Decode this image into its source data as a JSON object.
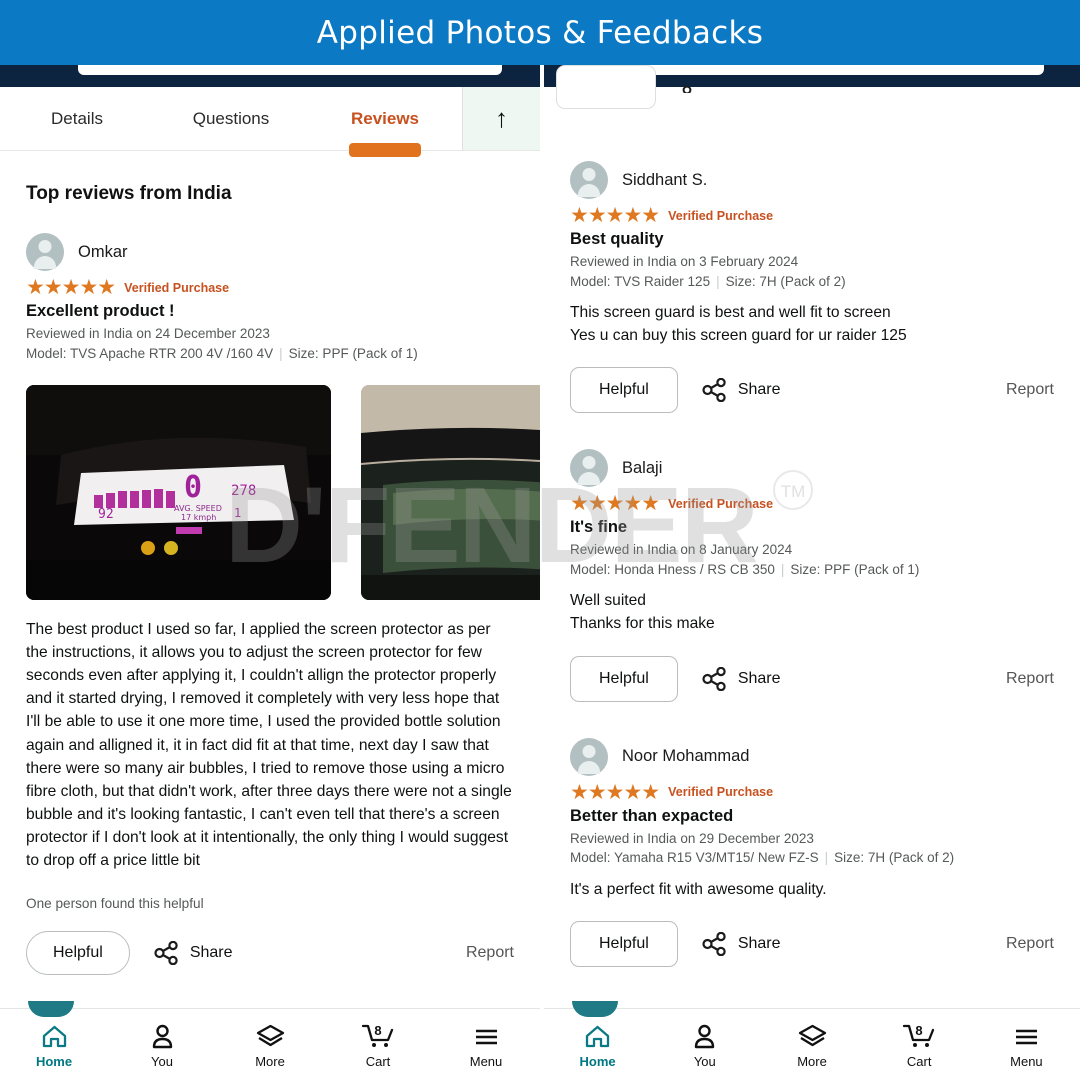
{
  "banner": {
    "title": "Applied Photos & Feedbacks"
  },
  "tabs": [
    {
      "label": "Details",
      "active": false
    },
    {
      "label": "Questions",
      "active": false
    },
    {
      "label": "Reviews",
      "active": true
    }
  ],
  "scroll_top_button": {
    "icon": "arrow-up-icon",
    "label": "↑"
  },
  "left_panel": {
    "section_title": "Top reviews from India",
    "review": {
      "reviewer": "Omkar",
      "stars": "★★★★★",
      "rating": 5,
      "verified": "Verified Purchase",
      "title": "Excellent product !",
      "date_line": "Reviewed in India on 24 December 2023",
      "model": "Model: TVS Apache RTR 200 4V /160 4V",
      "size": "Size: PPF (Pack of 1)",
      "body": "The best product I used so far, I applied the screen protector as per the instructions, it allows you to adjust the screen protector for few seconds even after applying it, I couldn't allign the protector properly and it started drying, I removed it completely with very less hope that I'll be able to use it one more time, I used the provided bottle solution again and alligned it, it in fact did fit at that time, next day I saw that there were so many air bubbles, I tried to remove those using a micro fibre cloth, but that didn't work, after three days there were not a single bubble and it's looking fantastic, I can't even tell that there's a screen protector if I don't look at it intentionally, the only thing I would suggest to drop off a price little bit",
      "helpful_count": "One person found this helpful",
      "helpful_label": "Helpful",
      "share_label": "Share",
      "report_label": "Report",
      "photos": [
        {
          "alt": "motorcycle-instrument-cluster-photo"
        },
        {
          "alt": "motorcycle-windscreen-photo"
        }
      ]
    }
  },
  "right_panel": {
    "cut_review": {
      "helpful_label": "",
      "share_label": "",
      "report_label": ""
    },
    "reviews": [
      {
        "reviewer": "Siddhant S.",
        "stars": "★★★★★",
        "rating": 5,
        "verified": "Verified Purchase",
        "title": "Best quality",
        "date_line": "Reviewed in India on 3 February 2024",
        "model": "Model: TVS Raider 125",
        "size": "Size: 7H (Pack of 2)",
        "body": "This screen guard is best and well fit to screen\nYes u can buy this screen guard for ur raider 125",
        "helpful_label": "Helpful",
        "share_label": "Share",
        "report_label": "Report"
      },
      {
        "reviewer": "Balaji",
        "stars": "★★★★★",
        "rating": 5,
        "verified": "Verified Purchase",
        "title": "It's fine",
        "date_line": "Reviewed in India on 8 January 2024",
        "model": "Model: Honda Hness / RS CB 350",
        "size": "Size: PPF (Pack of 1)",
        "body": "Well suited\nThanks for this make",
        "helpful_label": "Helpful",
        "share_label": "Share",
        "report_label": "Report"
      },
      {
        "reviewer": "Noor Mohammad",
        "stars": "★★★★★",
        "rating": 5,
        "verified": "Verified Purchase",
        "title": "Better than expacted",
        "date_line": "Reviewed in India on 29 December 2023",
        "model": "Model: Yamaha R15 V3/MT15/ New FZ-S",
        "size": "Size: 7H (Pack of 2)",
        "body": "It's a perfect fit with awesome quality.",
        "helpful_label": "Helpful",
        "share_label": "Share",
        "report_label": "Report"
      }
    ]
  },
  "bottom_nav": {
    "items": [
      {
        "label": "Home",
        "icon": "home-icon",
        "active": true,
        "badge": ""
      },
      {
        "label": "You",
        "icon": "person-icon",
        "active": false,
        "badge": ""
      },
      {
        "label": "More",
        "icon": "layers-icon",
        "active": false,
        "badge": ""
      },
      {
        "label": "Cart",
        "icon": "cart-icon",
        "active": false,
        "badge": "8"
      },
      {
        "label": "Menu",
        "icon": "hamburger-icon",
        "active": false,
        "badge": ""
      }
    ]
  },
  "watermark": {
    "text": "D'FENDER",
    "tm": "TM"
  },
  "colors": {
    "banner_blue": "#0c79c4",
    "navy": "#0d2440",
    "accent_orange": "#c7511f",
    "star_orange": "#de7921",
    "teal": "#007782"
  }
}
